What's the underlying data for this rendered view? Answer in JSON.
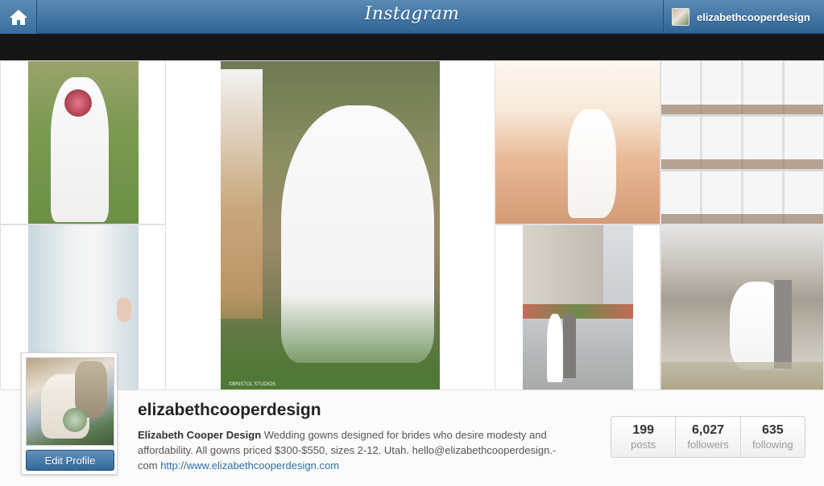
{
  "header": {
    "brand": "Instagram",
    "username": "elizabethcooperdesign"
  },
  "profile": {
    "username": "elizabethcooperdesign",
    "full_name": "Elizabeth Cooper Design",
    "bio_1": "Wedding gowns designed for brides who desire modesty and affordability. All gowns priced $300-$550, sizes 2-12. Utah. hello@elizabethcooperdesign.-",
    "bio_2": "com",
    "website": "http://www.elizabethcooperdesign.com",
    "edit_label": "Edit Profile"
  },
  "stats": [
    {
      "value": "199",
      "label": "posts"
    },
    {
      "value": "6,027",
      "label": "followers"
    },
    {
      "value": "635",
      "label": "following"
    }
  ],
  "photo_credit": "©BRISTOL STUDIOS",
  "colors": {
    "topbar": "#3a6f9e",
    "link": "#2e6ea6"
  }
}
